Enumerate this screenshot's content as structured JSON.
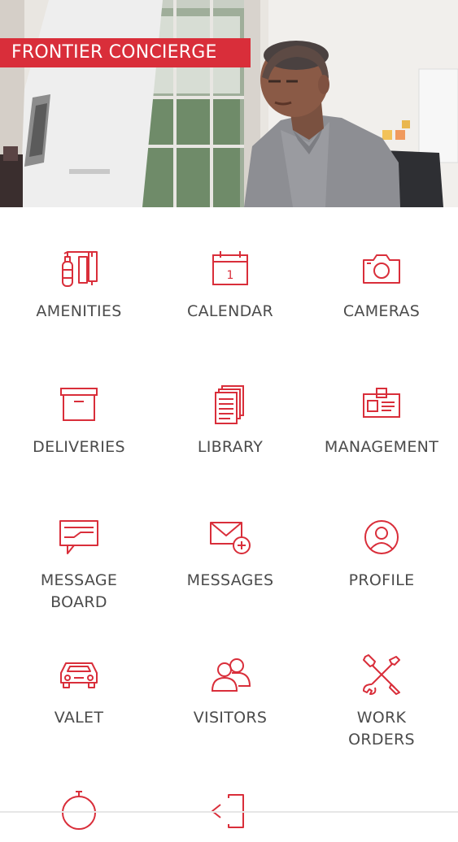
{
  "header": {
    "brand_title": "FRONTIER CONCIERGE"
  },
  "colors": {
    "accent": "#d92e3a",
    "label_text": "#4b4b4b",
    "background": "#ffffff"
  },
  "grid": {
    "items": [
      {
        "label": "AMENITIES",
        "icon": "fire-extinguisher-icon"
      },
      {
        "label": "CALENDAR",
        "icon": "calendar-icon"
      },
      {
        "label": "CAMERAS",
        "icon": "camera-icon"
      },
      {
        "label": "DELIVERIES",
        "icon": "box-icon"
      },
      {
        "label": "LIBRARY",
        "icon": "documents-icon"
      },
      {
        "label": "MANAGEMENT",
        "icon": "id-badge-icon"
      },
      {
        "label": "MESSAGE\nBOARD",
        "icon": "message-board-icon"
      },
      {
        "label": "MESSAGES",
        "icon": "envelope-plus-icon"
      },
      {
        "label": "PROFILE",
        "icon": "user-circle-icon"
      },
      {
        "label": "VALET",
        "icon": "car-icon"
      },
      {
        "label": "VISITORS",
        "icon": "users-icon"
      },
      {
        "label": "WORK\nORDERS",
        "icon": "wrench-screwdriver-icon"
      },
      {
        "label": "",
        "icon": "stopwatch-icon"
      },
      {
        "label": "",
        "icon": "exit-icon"
      }
    ]
  }
}
